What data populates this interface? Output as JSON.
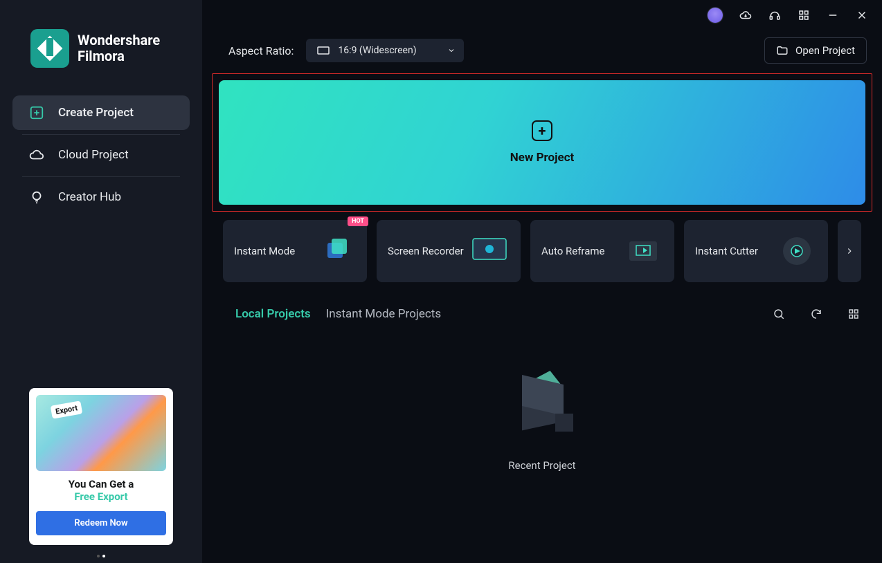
{
  "app": {
    "brand1": "Wondershare",
    "brand2": "Filmora"
  },
  "sidebar": {
    "items": [
      {
        "label": "Create Project"
      },
      {
        "label": "Cloud Project"
      },
      {
        "label": "Creator Hub"
      }
    ]
  },
  "promo": {
    "line1": "You Can Get a",
    "line2": "Free Export",
    "button": "Redeem Now"
  },
  "topbar": {
    "aspect_label": "Aspect Ratio:",
    "aspect_value": "16:9 (Widescreen)",
    "open_project": "Open Project"
  },
  "new_project_label": "New Project",
  "modes": [
    {
      "label": "Instant Mode",
      "hot": "HOT"
    },
    {
      "label": "Screen Recorder"
    },
    {
      "label": "Auto Reframe"
    },
    {
      "label": "Instant Cutter"
    }
  ],
  "tabs": {
    "active": "Local Projects",
    "inactive": "Instant Mode Projects"
  },
  "empty": {
    "label": "Recent Project"
  }
}
